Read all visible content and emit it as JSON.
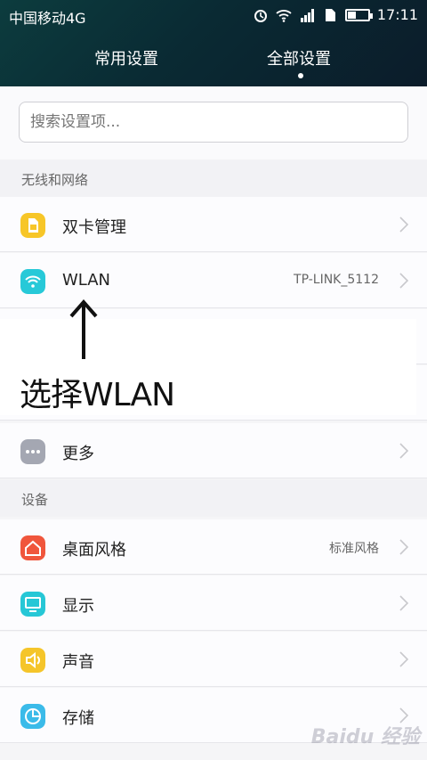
{
  "status": {
    "carrier": "中国移动4G",
    "time": "17:11",
    "network": "4G"
  },
  "tabs": [
    {
      "label": "常用设置"
    },
    {
      "label": "全部设置"
    }
  ],
  "search": {
    "placeholder": "搜索设置项..."
  },
  "sections": [
    {
      "title": "无线和网络"
    },
    {
      "title": "设备"
    }
  ],
  "rows": [
    {
      "label": "双卡管理",
      "value": "",
      "icon": "sim-card-icon",
      "color": "#f7c628"
    },
    {
      "label": "WLAN",
      "value": "TP-LINK_5112",
      "icon": "wifi-icon",
      "color": "#27c9d8"
    },
    {
      "label": "更多",
      "value": "",
      "icon": "more-dots-icon",
      "color": "#a4a7b2"
    },
    {
      "label": "桌面风格",
      "value": "标准风格",
      "icon": "home-icon",
      "color": "#f0563c"
    },
    {
      "label": "显示",
      "value": "",
      "icon": "display-icon",
      "color": "#26c7d6"
    },
    {
      "label": "声音",
      "value": "",
      "icon": "speaker-icon",
      "color": "#f5c52a"
    },
    {
      "label": "存储",
      "value": "",
      "icon": "storage-pie-icon",
      "color": "#3bbbe9"
    }
  ],
  "annotation": {
    "text": "选择WLAN"
  },
  "watermark": "Baidu 经验"
}
